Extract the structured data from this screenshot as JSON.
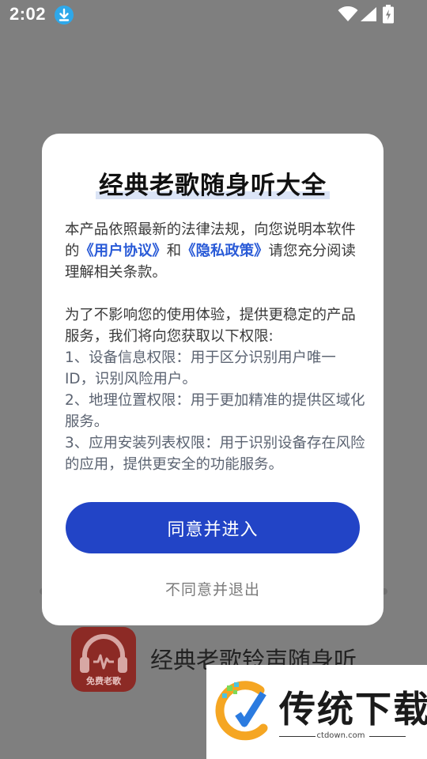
{
  "status_bar": {
    "time": "2:02"
  },
  "background_app": {
    "icon_badge": "免费老歌",
    "name": "经典老歌铃声随身听"
  },
  "dialog": {
    "title": "经典老歌随身听大全",
    "intro_before": "本产品依照最新的法律法规，向您说明本软件的",
    "user_agreement_link": "《用户协议》",
    "and": "和",
    "privacy_link": "《隐私政策》",
    "intro_after": "请您充分阅读理解相关条款。",
    "permissions_intro": "为了不影响您的使用体验，提供更稳定的产品服务，我们将向您获取以下权限:",
    "permissions": [
      "1、设备信息权限：用于区分识别用户唯一ID，识别风险用户。",
      "2、地理位置权限：用于更加精准的提供区域化服务。",
      "3、应用安装列表权限：用于识别设备存在风险的应用，提供更安全的功能服务。"
    ],
    "agree_label": "同意并进入",
    "disagree_label": "不同意并退出"
  },
  "watermark": {
    "brand": "传统下载",
    "site": "ctdown.com"
  },
  "colors": {
    "primary_button": "#2244c6",
    "link": "#2a5bd7",
    "overlay": "#7f7f7f"
  }
}
